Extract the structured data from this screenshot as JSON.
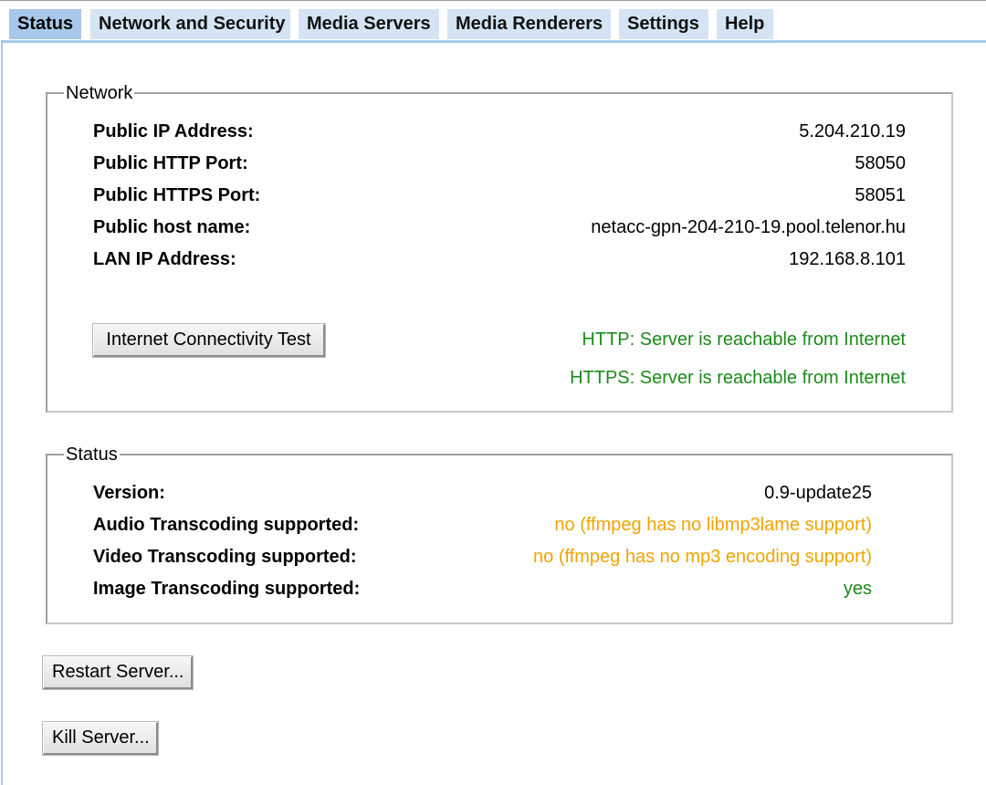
{
  "tabs": [
    {
      "label": "Status",
      "active": true
    },
    {
      "label": "Network and Security",
      "active": false
    },
    {
      "label": "Media Servers",
      "active": false
    },
    {
      "label": "Media Renderers",
      "active": false
    },
    {
      "label": "Settings",
      "active": false
    },
    {
      "label": "Help",
      "active": false
    }
  ],
  "network": {
    "legend": "Network",
    "rows": [
      {
        "label": "Public IP Address:",
        "value": "5.204.210.19"
      },
      {
        "label": "Public HTTP Port:",
        "value": "58050"
      },
      {
        "label": "Public HTTPS Port:",
        "value": "58051"
      },
      {
        "label": "Public host name:",
        "value": "netacc-gpn-204-210-19.pool.telenor.hu"
      },
      {
        "label": "LAN IP Address:",
        "value": "192.168.8.101"
      }
    ],
    "test_button": "Internet Connectivity Test",
    "http_result": "HTTP: Server is reachable from Internet",
    "https_result": "HTTPS: Server is reachable from Internet"
  },
  "status": {
    "legend": "Status",
    "rows": [
      {
        "label": "Version:",
        "value": "0.9-update25"
      },
      {
        "label": "Audio Transcoding supported:",
        "value": "no (ffmpeg has no libmp3lame support)"
      },
      {
        "label": "Video Transcoding supported:",
        "value": "no (ffmpeg has no mp3 encoding support)"
      },
      {
        "label": "Image Transcoding supported:",
        "value": "yes"
      }
    ]
  },
  "actions": {
    "restart_label": "Restart Server...",
    "kill_label": "Kill Server..."
  },
  "colors": {
    "tab_active": "#a7c8ea",
    "tab_inactive": "#d4e4f4",
    "ok": "#1a8a1a",
    "warning": "#f0a400"
  }
}
